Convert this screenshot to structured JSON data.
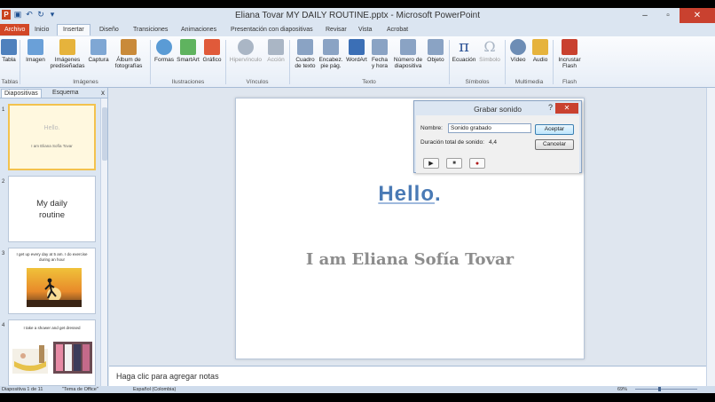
{
  "window": {
    "title": "Eliana Tovar MY DAILY ROUTINE.pptx - Microsoft PowerPoint"
  },
  "tabs": [
    {
      "label": "Archivo"
    },
    {
      "label": "Inicio"
    },
    {
      "label": "Insertar"
    },
    {
      "label": "Diseño"
    },
    {
      "label": "Transiciones"
    },
    {
      "label": "Animaciones"
    },
    {
      "label": "Presentación con diapositivas"
    },
    {
      "label": "Revisar"
    },
    {
      "label": "Vista"
    },
    {
      "label": "Acrobat"
    }
  ],
  "ribbon": {
    "buttons": [
      {
        "label": "Tabla",
        "color": "#4f81bd"
      },
      {
        "label": "Imagen",
        "color": "#6aa0d8"
      },
      {
        "label": "Imágenes prediseñadas",
        "color": "#e6b33c"
      },
      {
        "label": "Captura",
        "color": "#7fa7d4"
      },
      {
        "label": "Álbum de fotografías",
        "color": "#c98a3a"
      },
      {
        "label": "Formas",
        "color": "#5a9bd5"
      },
      {
        "label": "SmartArt",
        "color": "#5fb35f"
      },
      {
        "label": "Gráfico",
        "color": "#e05a3a"
      },
      {
        "label": "Hipervínculo",
        "color": "#aab6c5"
      },
      {
        "label": "Acción",
        "color": "#aab6c5"
      },
      {
        "label": "Cuadro de texto",
        "color": "#8aa3c4"
      },
      {
        "label": "Encabez. pie pág.",
        "color": "#8aa3c4"
      },
      {
        "label": "WordArt",
        "color": "#3b6fb6"
      },
      {
        "label": "Fecha y hora",
        "color": "#8aa3c4"
      },
      {
        "label": "Número de diapositiva",
        "color": "#8aa3c4"
      },
      {
        "label": "Objeto",
        "color": "#8aa3c4"
      },
      {
        "label": "Ecuación",
        "color": "#2f5597"
      },
      {
        "label": "Símbolo",
        "color": "#aab6c5"
      },
      {
        "label": "Vídeo",
        "color": "#6d8db5"
      },
      {
        "label": "Audio",
        "color": "#e6b33c"
      },
      {
        "label": "Incrustar Flash",
        "color": "#c9412f"
      }
    ],
    "groups": [
      {
        "label": "Tablas"
      },
      {
        "label": "Imágenes"
      },
      {
        "label": "Ilustraciones"
      },
      {
        "label": "Vínculos"
      },
      {
        "label": "Texto"
      },
      {
        "label": "Símbolos"
      },
      {
        "label": "Multimedia"
      },
      {
        "label": "Flash"
      }
    ]
  },
  "left_panel": {
    "tabs": [
      {
        "label": "Diapositivas"
      },
      {
        "label": "Esquema"
      }
    ],
    "close": "x",
    "slides": [
      {
        "number": "1",
        "title": "Hello.",
        "subtitle": "I am Eliana Sofía Tovar"
      },
      {
        "number": "2",
        "title": "My daily routine"
      },
      {
        "number": "3",
        "text": "I get up every day at 5 am. I do exercise during an hour"
      },
      {
        "number": "4",
        "text": "I take a shower and get dressed"
      }
    ]
  },
  "slide": {
    "title": "Hello",
    "title_dot": ".",
    "subtitle": "I am Eliana Sofía Tovar"
  },
  "dialog": {
    "title": "Grabar sonido",
    "help": "?",
    "close": "✕",
    "name_label": "Nombre:",
    "name_value": "Sonido grabado",
    "duration_label": "Duración total de sonido:",
    "duration_value": "4,4",
    "ok_label": "Aceptar",
    "cancel_label": "Cancelar",
    "controls": [
      {
        "icon": "play-icon",
        "glyph": "▶"
      },
      {
        "icon": "stop-icon",
        "glyph": "■"
      },
      {
        "icon": "record-icon",
        "glyph": "●"
      }
    ]
  },
  "notes": {
    "placeholder": "Haga clic para agregar notas"
  },
  "status": {
    "slide_info": "Diapositiva 1 de 11",
    "theme": "\"Tema de Office\"",
    "language": "Español (Colombia)",
    "zoom": "69%"
  }
}
